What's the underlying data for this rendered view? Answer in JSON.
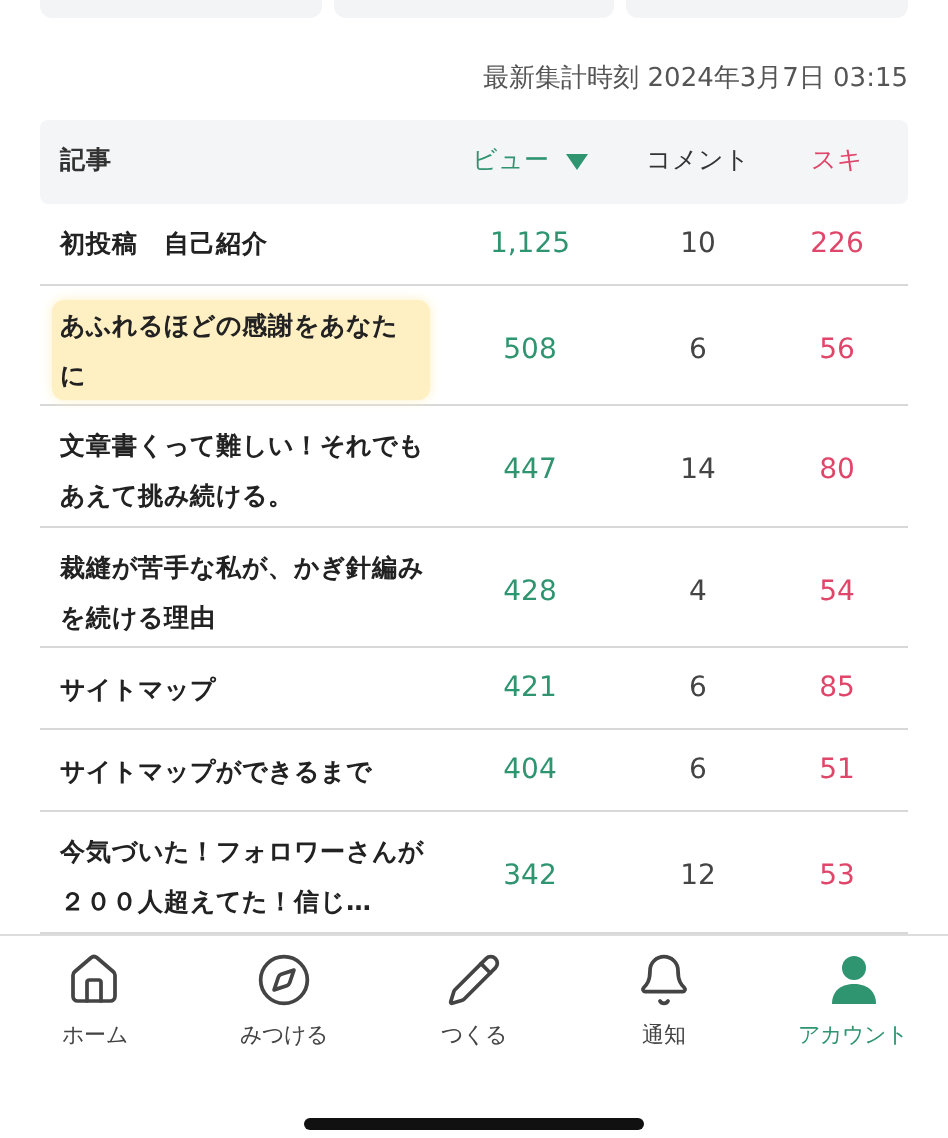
{
  "summary_cards": [
    {
      "kind": "card"
    },
    {
      "kind": "card"
    },
    {
      "kind": "card"
    }
  ],
  "updated_at": "最新集計時刻 2024年3月7日 03:15",
  "table": {
    "columns": [
      {
        "label": "記事",
        "kind": "title",
        "sorted": false
      },
      {
        "label": "ビュー",
        "kind": "views",
        "sorted": true
      },
      {
        "label": "コメント",
        "kind": "comments",
        "sorted": false
      },
      {
        "label": "スキ",
        "kind": "likes",
        "sorted": false
      }
    ],
    "rows": [
      {
        "title": "初投稿　自己紹介",
        "highlighted": false,
        "views": "1,125",
        "comments": "10",
        "likes": "226"
      },
      {
        "title": "あふれるほどの感謝をあなたに",
        "highlighted": true,
        "views": "508",
        "comments": "6",
        "likes": "56"
      },
      {
        "title": "文章書くって難しい！それでもあえて挑み続ける。",
        "highlighted": false,
        "views": "447",
        "comments": "14",
        "likes": "80"
      },
      {
        "title": "裁縫が苦手な私が、かぎ針編みを続ける理由",
        "highlighted": false,
        "views": "428",
        "comments": "4",
        "likes": "54"
      },
      {
        "title": "サイトマップ",
        "highlighted": false,
        "views": "421",
        "comments": "6",
        "likes": "85"
      },
      {
        "title": "サイトマップができるまで",
        "highlighted": false,
        "views": "404",
        "comments": "6",
        "likes": "51"
      },
      {
        "title": "今気づいた！フォロワーさんが２００人超えてた！信じ…",
        "highlighted": false,
        "views": "342",
        "comments": "12",
        "likes": "53"
      }
    ]
  },
  "nav": [
    {
      "label": "ホーム",
      "kind": "home",
      "selected": false
    },
    {
      "label": "みつける",
      "kind": "compass",
      "selected": false
    },
    {
      "label": "つくる",
      "kind": "pencil",
      "selected": false
    },
    {
      "label": "通知",
      "kind": "bell",
      "selected": false
    },
    {
      "label": "アカウント",
      "kind": "person",
      "selected": true
    }
  ]
}
